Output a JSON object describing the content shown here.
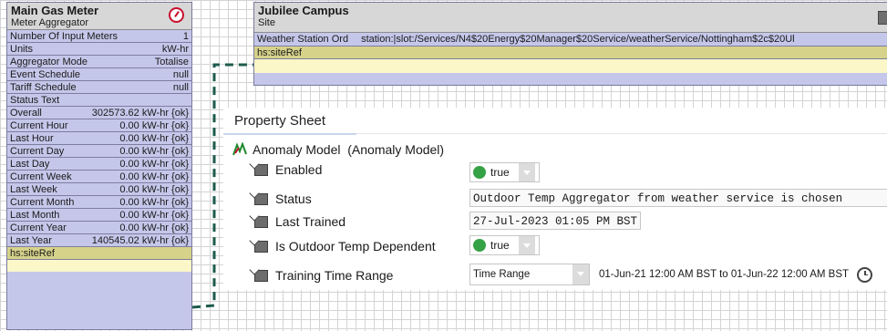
{
  "meter": {
    "title": "Main Gas Meter",
    "type": "Meter Aggregator",
    "icon": "gas-meter-icon",
    "rows": [
      {
        "label": "Number Of Input Meters",
        "value": "1"
      },
      {
        "label": "Units",
        "value": "kW-hr"
      },
      {
        "label": "Aggregator Mode",
        "value": "Totalise"
      },
      {
        "label": "Event Schedule",
        "value": "null"
      },
      {
        "label": "Tariff Schedule",
        "value": "null"
      },
      {
        "label": "Status Text",
        "value": ""
      },
      {
        "label": "Overall",
        "value": "302573.62 kW-hr {ok}"
      },
      {
        "label": "Current Hour",
        "value": "0.00 kW-hr {ok}"
      },
      {
        "label": "Last Hour",
        "value": "0.00 kW-hr {ok}"
      },
      {
        "label": "Current Day",
        "value": "0.00 kW-hr {ok}"
      },
      {
        "label": "Last Day",
        "value": "0.00 kW-hr {ok}"
      },
      {
        "label": "Current Week",
        "value": "0.00 kW-hr {ok}"
      },
      {
        "label": "Last Week",
        "value": "0.00 kW-hr {ok}"
      },
      {
        "label": "Current Month",
        "value": "0.00 kW-hr {ok}"
      },
      {
        "label": "Last Month",
        "value": "0.00 kW-hr {ok}"
      },
      {
        "label": "Current Year",
        "value": "0.00 kW-hr {ok}"
      },
      {
        "label": "Last Year",
        "value": "140545.02 kW-hr {ok}"
      }
    ],
    "link_slot": "hs:siteRef"
  },
  "campus": {
    "title": "Jubilee Campus",
    "type": "Site",
    "icon": "site-icon",
    "weather_label": "Weather Station Ord",
    "weather_value": "station:|slot:/Services/N4$20Energy$20Manager$20Service/weatherService/Nottingham$2c$20Ul",
    "link_slot": "hs:siteRef"
  },
  "property_sheet": {
    "tab": "Property Sheet",
    "root_label": "Anomaly Model  (Anomaly Model)",
    "root_icon": "anomaly-model-icon",
    "enabled": {
      "label": "Enabled",
      "value": "true"
    },
    "status": {
      "label": "Status",
      "value": "Outdoor Temp Aggregator from weather service is chosen"
    },
    "last_trained": {
      "label": "Last Trained",
      "value": "27-Jul-2023 01:05 PM BST"
    },
    "outdoor_temp": {
      "label": "Is Outdoor Temp Dependent",
      "value": "true"
    },
    "training_range": {
      "label": "Training Time Range",
      "select_value": "Time Range",
      "range": "01-Jun-21 12:00 AM BST to 01-Jun-22 12:00 AM BST"
    }
  },
  "colors": {
    "block_fill": "#c5c7ea",
    "header_fill": "#d7d7d7",
    "link_line": "#1d5b4d",
    "true_dot": "#35a245"
  }
}
